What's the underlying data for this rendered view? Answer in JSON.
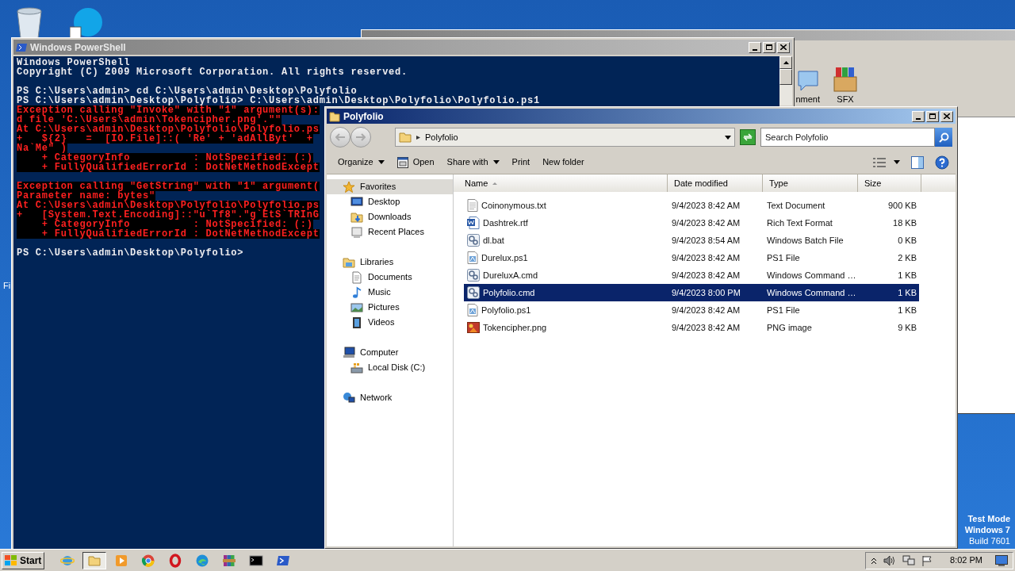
{
  "desktop": {
    "icon_labels": [
      "Fi"
    ],
    "notice": [
      "Test Mode",
      "Windows 7",
      "Build 7601"
    ]
  },
  "background_window": {
    "toolbar_labels": [
      "nment",
      "SFX"
    ]
  },
  "powershell": {
    "title": "Windows PowerShell",
    "lines": [
      {
        "text": "Windows PowerShell",
        "kind": "output"
      },
      {
        "text": "Copyright (C) 2009 Microsoft Corporation. All rights reserved.",
        "kind": "output"
      },
      {
        "kind": "blank"
      },
      {
        "text": "PS C:\\Users\\admin> cd C:\\Users\\admin\\Desktop\\Polyfolio",
        "kind": "output"
      },
      {
        "text": "PS C:\\Users\\admin\\Desktop\\Polyfolio> C:\\Users\\admin\\Desktop\\Polyfolio\\Polyfolio.ps1",
        "kind": "output"
      },
      {
        "text": "Exception calling \"Invoke\" with \"1\" argument(s):",
        "kind": "error"
      },
      {
        "text": "d file 'C:\\Users\\admin\\Tokencipher.png'.\"\"",
        "kind": "error"
      },
      {
        "text": "At C:\\Users\\admin\\Desktop\\Polyfolio\\Polyfolio.ps",
        "kind": "error"
      },
      {
        "text": "+   ${2}   =  [IO.File]::( 'Re' + 'adAllByt'  +",
        "kind": "error"
      },
      {
        "text": "Na`Me\" )",
        "kind": "error"
      },
      {
        "text": "    + CategoryInfo          : NotSpecified: (:)",
        "kind": "error"
      },
      {
        "text": "    + FullyQualifiedErrorId : DotNetMethodExcept",
        "kind": "error"
      },
      {
        "kind": "blank"
      },
      {
        "text": "Exception calling \"GetString\" with \"1\" argument(",
        "kind": "error"
      },
      {
        "text": "Parameter name: bytes\"",
        "kind": "error"
      },
      {
        "text": "At C:\\Users\\admin\\Desktop\\Polyfolio\\Polyfolio.ps",
        "kind": "error"
      },
      {
        "text": "+   [System.Text.Encoding]::\"u`Tf8\".\"g`EtS`TRInG",
        "kind": "error"
      },
      {
        "text": "    + CategoryInfo          : NotSpecified: (:)",
        "kind": "error"
      },
      {
        "text": "    + FullyQualifiedErrorId : DotNetMethodExcept",
        "kind": "error"
      },
      {
        "kind": "blank"
      },
      {
        "text": "PS C:\\Users\\admin\\Desktop\\Polyfolio>",
        "kind": "output"
      }
    ]
  },
  "explorer": {
    "title": "Polyfolio",
    "address": "Polyfolio",
    "search": {
      "placeholder": "Search Polyfolio"
    },
    "toolbar": [
      {
        "label": "Organize",
        "kind": "menu"
      },
      {
        "label": "Open",
        "kind": "open"
      },
      {
        "label": "Share with",
        "kind": "menu"
      },
      {
        "label": "Print",
        "kind": "plain"
      },
      {
        "label": "New folder",
        "kind": "plain"
      }
    ],
    "nav": [
      {
        "label": "Favorites",
        "kind": "star",
        "selected": true,
        "children": [
          {
            "label": "Desktop",
            "kind": "desktop",
            "selected": false
          },
          {
            "label": "Downloads",
            "kind": "downloads",
            "selected": false
          },
          {
            "label": "Recent Places",
            "kind": "recent",
            "selected": false
          }
        ]
      },
      {
        "label": "Libraries",
        "kind": "library",
        "selected": false,
        "children": [
          {
            "label": "Documents",
            "kind": "document",
            "selected": false
          },
          {
            "label": "Music",
            "kind": "music",
            "selected": false
          },
          {
            "label": "Pictures",
            "kind": "pictures",
            "selected": false
          },
          {
            "label": "Videos",
            "kind": "videos",
            "selected": false
          }
        ]
      },
      {
        "label": "Computer",
        "kind": "computer",
        "selected": false,
        "children": [
          {
            "label": "Local Disk (C:)",
            "kind": "disk",
            "selected": false
          }
        ]
      },
      {
        "label": "Network",
        "kind": "network",
        "selected": false
      }
    ],
    "columns": [
      "Name",
      "Date modified",
      "Type",
      "Size"
    ],
    "files": [
      {
        "name": "Coinonymous.txt",
        "date": "9/4/2023 8:42 AM",
        "type": "Text Document",
        "size": "900 KB",
        "kind": "text",
        "selected": false
      },
      {
        "name": "Dashtrek.rtf",
        "date": "9/4/2023 8:42 AM",
        "type": "Rich Text Format",
        "size": "18 KB",
        "kind": "word",
        "selected": false
      },
      {
        "name": "dl.bat",
        "date": "9/4/2023 8:54 AM",
        "type": "Windows Batch File",
        "size": "0 KB",
        "kind": "script",
        "selected": false
      },
      {
        "name": "Durelux.ps1",
        "date": "9/4/2023 8:42 AM",
        "type": "PS1 File",
        "size": "2 KB",
        "kind": "ps1",
        "selected": false
      },
      {
        "name": "DureluxA.cmd",
        "date": "9/4/2023 8:42 AM",
        "type": "Windows Command …",
        "size": "1 KB",
        "kind": "script",
        "selected": false
      },
      {
        "name": "Polyfolio.cmd",
        "date": "9/4/2023 8:00 PM",
        "type": "Windows Command …",
        "size": "1 KB",
        "kind": "script",
        "selected": true
      },
      {
        "name": "Polyfolio.ps1",
        "date": "9/4/2023 8:42 AM",
        "type": "PS1 File",
        "size": "1 KB",
        "kind": "ps1",
        "selected": false
      },
      {
        "name": "Tokencipher.png",
        "date": "9/4/2023 8:42 AM",
        "type": "PNG image",
        "size": "9 KB",
        "kind": "image",
        "selected": false
      }
    ]
  },
  "taskbar": {
    "start": "Start",
    "apps": [
      {
        "kind": "ie",
        "active": false
      },
      {
        "kind": "folder",
        "active": true
      },
      {
        "kind": "media",
        "active": false
      },
      {
        "kind": "chrome",
        "active": false
      },
      {
        "kind": "opera",
        "active": false
      },
      {
        "kind": "edge",
        "active": false
      },
      {
        "kind": "archive",
        "active": false
      },
      {
        "kind": "cmd",
        "active": false
      },
      {
        "kind": "powershell",
        "active": false
      }
    ],
    "clock": "8:02 PM"
  }
}
